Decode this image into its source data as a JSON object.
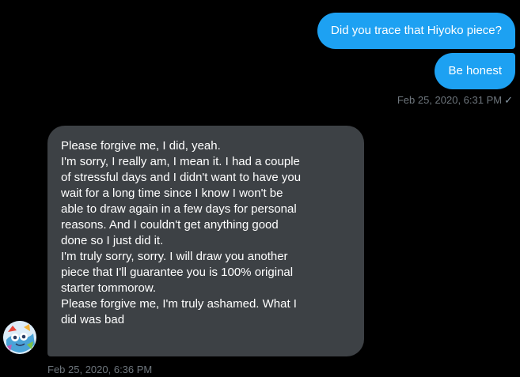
{
  "messages_sent": [
    {
      "text": "Did you trace that Hiyoko piece?"
    },
    {
      "text": "Be honest"
    }
  ],
  "sent_meta": {
    "timestamp": "Feb 25, 2020, 6:31 PM",
    "status_icon": "✓"
  },
  "received_message": {
    "lines": [
      "Please forgive me, I did, yeah.",
      "I'm sorry, I really am, I mean it. I had a couple",
      "of stressful days and I didn't want to have you",
      "wait for a long time since I know I won't be",
      "able to draw again in a few days for personal",
      "reasons. And I couldn't get anything good",
      "done so I just did it.",
      "I'm truly sorry, sorry. I will draw you another",
      "piece that I'll guarantee you is 100% original",
      "starter tommorow.",
      "Please forgive me, I'm truly ashamed. What I",
      "did was bad"
    ]
  },
  "received_meta": {
    "timestamp": "Feb 25, 2020, 6:36 PM"
  },
  "colors": {
    "background": "#000000",
    "sent_bubble": "#1da1f2",
    "received_bubble": "#3d4145",
    "meta_text": "#6e767d"
  },
  "icons": {
    "read_status": "check-icon",
    "sender_avatar": "avatar"
  }
}
